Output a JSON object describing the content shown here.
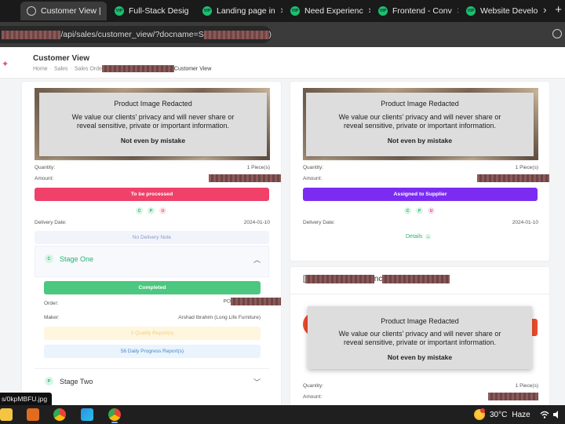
{
  "browser": {
    "tabs": [
      {
        "label": "Customer View |",
        "active": true,
        "icon": "globe-icon"
      },
      {
        "label": "Full-Stack Desig",
        "icon": "fiverr-icon",
        "icon_text": "VIP"
      },
      {
        "label": "Landing page in",
        "icon": "fiverr-icon",
        "icon_text": "VIP"
      },
      {
        "label": "Need Experienc",
        "icon": "fiverr-icon",
        "icon_text": "VIP"
      },
      {
        "label": "Frontend - Conv",
        "icon": "fiverr-icon",
        "icon_text": "VIP"
      },
      {
        "label": "Website Develo",
        "icon": "fiverr-icon",
        "icon_text": "VIP"
      }
    ],
    "new_tab_label": "+",
    "close_label": "✕",
    "url_prefix": "/api/sales/customer_view/?docname=S",
    "url_suffix": ")",
    "status_link": "s/0kpMBFU.jpg"
  },
  "header": {
    "title": "Customer View",
    "breadcrumb": [
      "Home",
      "Sales",
      "Sales Orde"
    ],
    "breadcrumb_sep": "·",
    "breadcrumb_current": "Customer View"
  },
  "notice": {
    "title": "Product Image Redacted",
    "body_line1": "We value our clients' privacy and will never share or",
    "body_line2": "reveal sensitive, private or important information.",
    "emphasis": "Not even by mistake"
  },
  "left_card": {
    "quantity_label": "Quantity:",
    "quantity_value": "1 Piece(s)",
    "amount_label": "Amount:",
    "status": "To be processed",
    "status_color": "#ef4169",
    "chips": [
      {
        "letter": "C",
        "bg": "#d9f5e6",
        "fg": "#22b573"
      },
      {
        "letter": "P",
        "bg": "#d9f5e6",
        "fg": "#22b573"
      },
      {
        "letter": "U",
        "bg": "#fde3e8",
        "fg": "#ef4169"
      }
    ],
    "delivery_label": "Delivery Date:",
    "delivery_value": "2024-01-10",
    "delivery_note": "No Delivery Note",
    "stage_one": {
      "badge": "C",
      "label": "Stage One",
      "status": "Completed",
      "status_color": "#4cc77f",
      "order_label": "Order:",
      "order_value": "PO",
      "maker_label": "Maker:",
      "maker_value": "Arshad Ibrahim (Long Life Furniture)",
      "quality_reports": "0 Quality Report(s)",
      "progress_reports": "56 Daily Progress Report(s)"
    },
    "stage_two": {
      "badge": "P",
      "label": "Stage Two"
    }
  },
  "right_card": {
    "quantity_label": "Quantity:",
    "quantity_value": "1 Piece(s)",
    "amount_label": "Amount:",
    "status": "Assigned to Supplier",
    "status_color": "#7b2cf0",
    "chips": [
      {
        "letter": "C",
        "bg": "#d9f5e6",
        "fg": "#22b573"
      },
      {
        "letter": "P",
        "bg": "#d9f5e6",
        "fg": "#22b573"
      },
      {
        "letter": "U",
        "bg": "#f7e3f2",
        "fg": "#c2407e"
      }
    ],
    "delivery_label": "Delivery Date:",
    "delivery_value": "2024-01-10",
    "details_label": "Details"
  },
  "second_card": {
    "title_open": "[",
    "title_mid": "nc",
    "quantity_label": "Quantity:",
    "quantity_value": "1 Piece(s)",
    "amount_label": "Amount:"
  },
  "taskbar": {
    "temperature": "30°C",
    "weather": "Haze"
  }
}
